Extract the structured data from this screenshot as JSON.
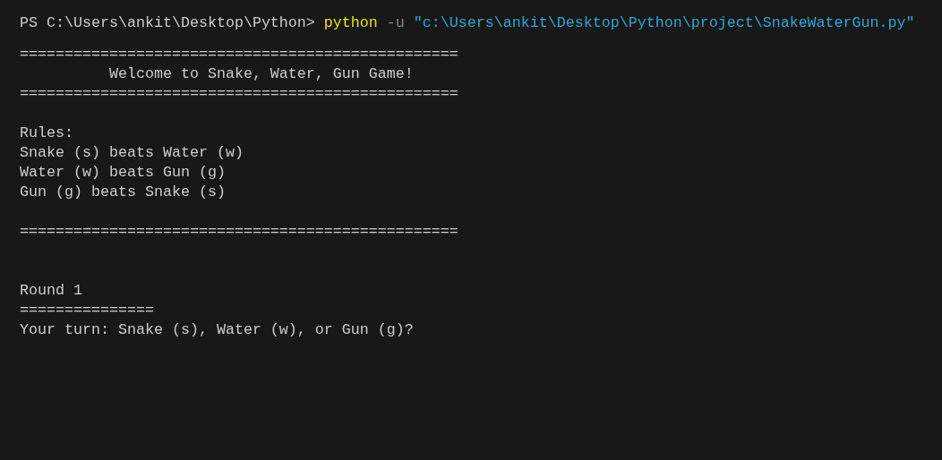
{
  "terminal": {
    "prompt": {
      "path": "PS C:\\Users\\ankit\\Desktop\\Python> ",
      "command": "python",
      "flag": "-u",
      "argument": "\"c:\\Users\\ankit\\Desktop\\Python\\project\\SnakeWaterGun.py\""
    },
    "output_blocks": [
      {
        "lines": [
          "=================================================",
          "          Welcome to Snake, Water, Gun Game!",
          "================================================="
        ]
      },
      {
        "lines": [
          "Rules:",
          "Snake (s) beats Water (w)",
          "Water (w) beats Gun (g)",
          "Gun (g) beats Snake (s)"
        ]
      },
      {
        "lines": [
          "================================================="
        ]
      },
      {
        "lines": [
          "Round 1",
          "===============",
          "Your turn: Snake (s), Water (w), or Gun (g)?"
        ]
      }
    ]
  }
}
